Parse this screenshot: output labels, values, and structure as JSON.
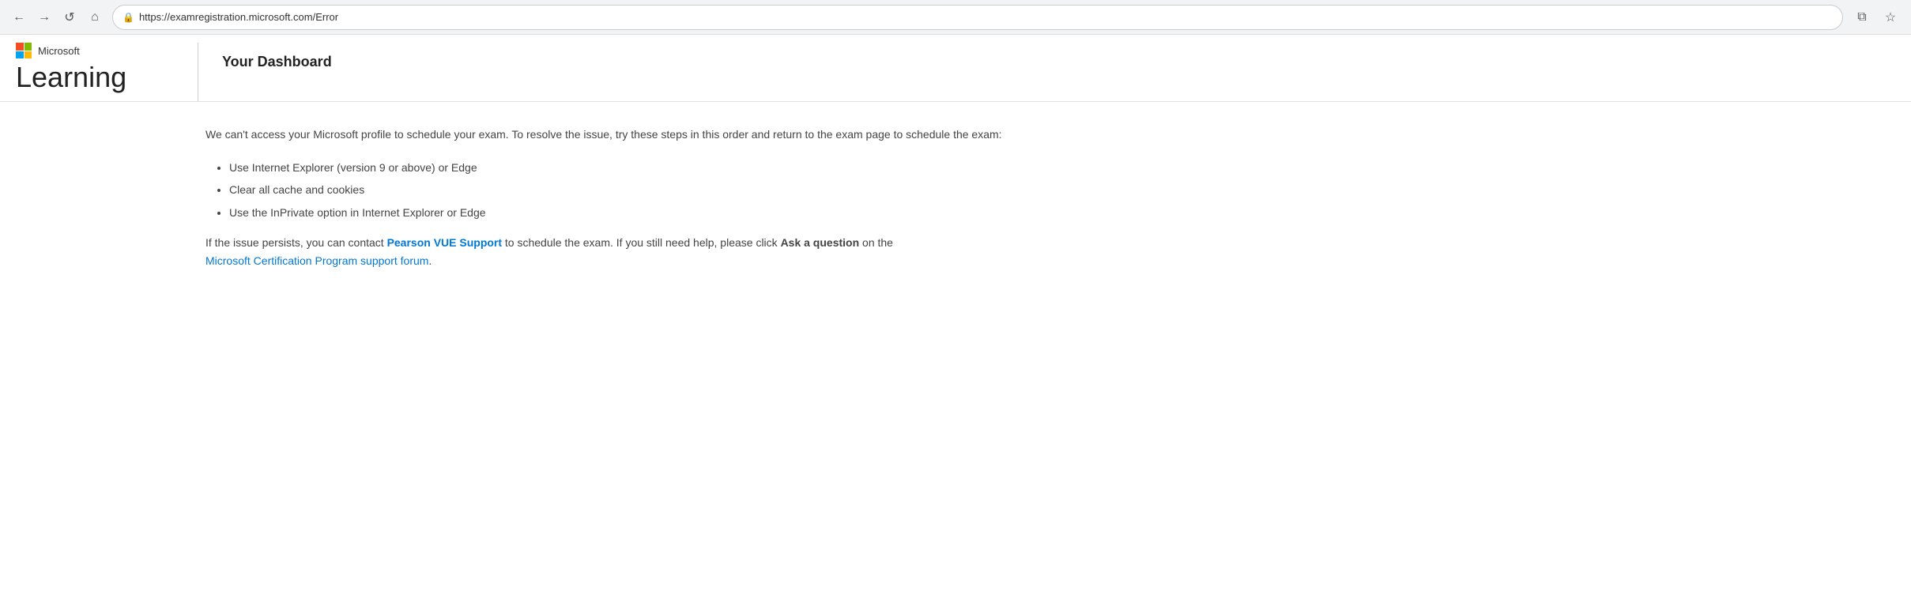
{
  "browser": {
    "url": "https://examregistration.microsoft.com/Error",
    "back_label": "←",
    "forward_label": "→",
    "refresh_label": "↺",
    "home_label": "⌂",
    "split_screen_label": "⧉",
    "favorites_label": "☆"
  },
  "header": {
    "microsoft_text": "Microsoft",
    "site_title": "Learning",
    "dashboard_title": "Your Dashboard"
  },
  "content": {
    "error_intro": "We can't access your Microsoft profile to schedule your exam. To resolve the issue, try these steps in this order and return to the exam page to schedule the exam:",
    "steps": [
      "Use Internet Explorer (version 9 or above) or Edge",
      "Clear all cache and cookies",
      "Use the InPrivate option in Internet Explorer or Edge"
    ],
    "contact_prefix": "If the issue persists, you can contact ",
    "pearson_link": "Pearson VUE Support",
    "contact_middle": " to schedule the exam. If you still need help, please click ",
    "ask_link": "Ask a question",
    "contact_suffix": " on the ",
    "forum_link": "Microsoft Certification Program support forum",
    "contact_end": "."
  }
}
